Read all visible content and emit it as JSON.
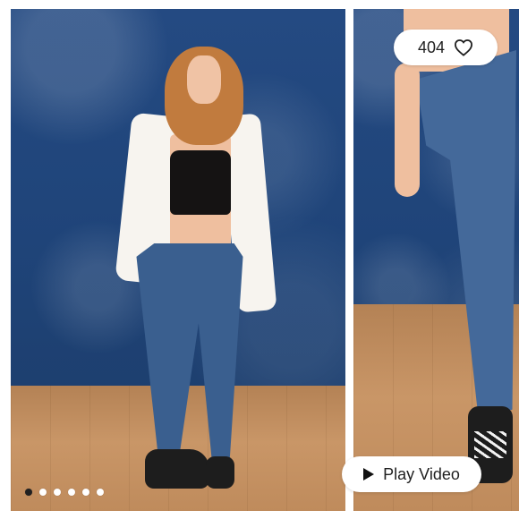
{
  "listing": {
    "like_count": "404"
  },
  "video": {
    "play_label": "Play Video"
  },
  "gallery": {
    "total_images": 6,
    "active_index": 0
  },
  "icons": {
    "like": "heart-icon",
    "play": "play-icon"
  },
  "colors": {
    "backdrop": "#23497f",
    "floor": "#c99667",
    "pill_bg": "#ffffff",
    "dot_active": "#202020",
    "dot_inactive": "#ffffff"
  }
}
